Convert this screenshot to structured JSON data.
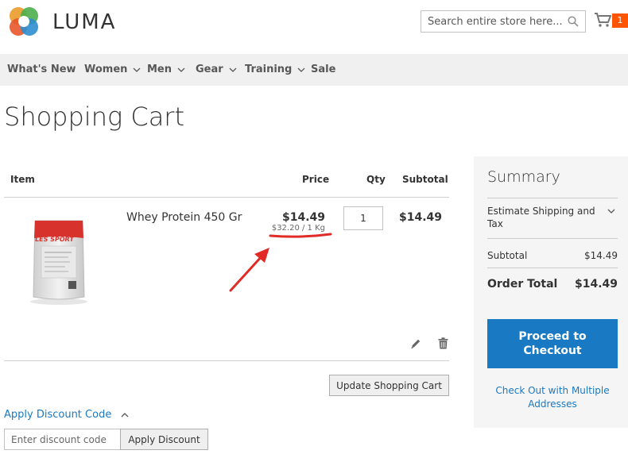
{
  "header": {
    "logo_text": "LUMA",
    "search_placeholder": "Search entire store here...",
    "cart_count": "1"
  },
  "nav": {
    "items": [
      {
        "label": "What's New",
        "has_submenu": false
      },
      {
        "label": "Women",
        "has_submenu": true
      },
      {
        "label": "Men",
        "has_submenu": true
      },
      {
        "label": "Gear",
        "has_submenu": true
      },
      {
        "label": "Training",
        "has_submenu": true
      },
      {
        "label": "Sale",
        "has_submenu": false
      }
    ]
  },
  "page": {
    "title": "Shopping Cart"
  },
  "cart": {
    "columns": {
      "item": "Item",
      "price": "Price",
      "qty": "Qty",
      "subtotal": "Subtotal"
    },
    "items": [
      {
        "name": "Whey Protein 450 Gr",
        "price": "$14.49",
        "unit_price": "$32.20 / 1 Kg",
        "qty": "1",
        "subtotal": "$14.49",
        "package_brand": "LES SPORT"
      }
    ],
    "update_button": "Update Shopping Cart"
  },
  "discount": {
    "toggle_label": "Apply Discount Code",
    "input_placeholder": "Enter discount code",
    "apply_button": "Apply Discount"
  },
  "summary": {
    "title": "Summary",
    "estimate_label": "Estimate Shipping and Tax",
    "subtotal_label": "Subtotal",
    "subtotal_value": "$14.49",
    "order_total_label": "Order Total",
    "order_total_value": "$14.49",
    "checkout_button": "Proceed to Checkout",
    "multi_address_link": "Check Out with Multiple Addresses"
  },
  "colors": {
    "accent": "#1979c3",
    "cart_badge": "#ff5501",
    "annotation": "#e02b27",
    "nav_bg": "#f0f0f0",
    "summary_bg": "#f5f5f5"
  }
}
